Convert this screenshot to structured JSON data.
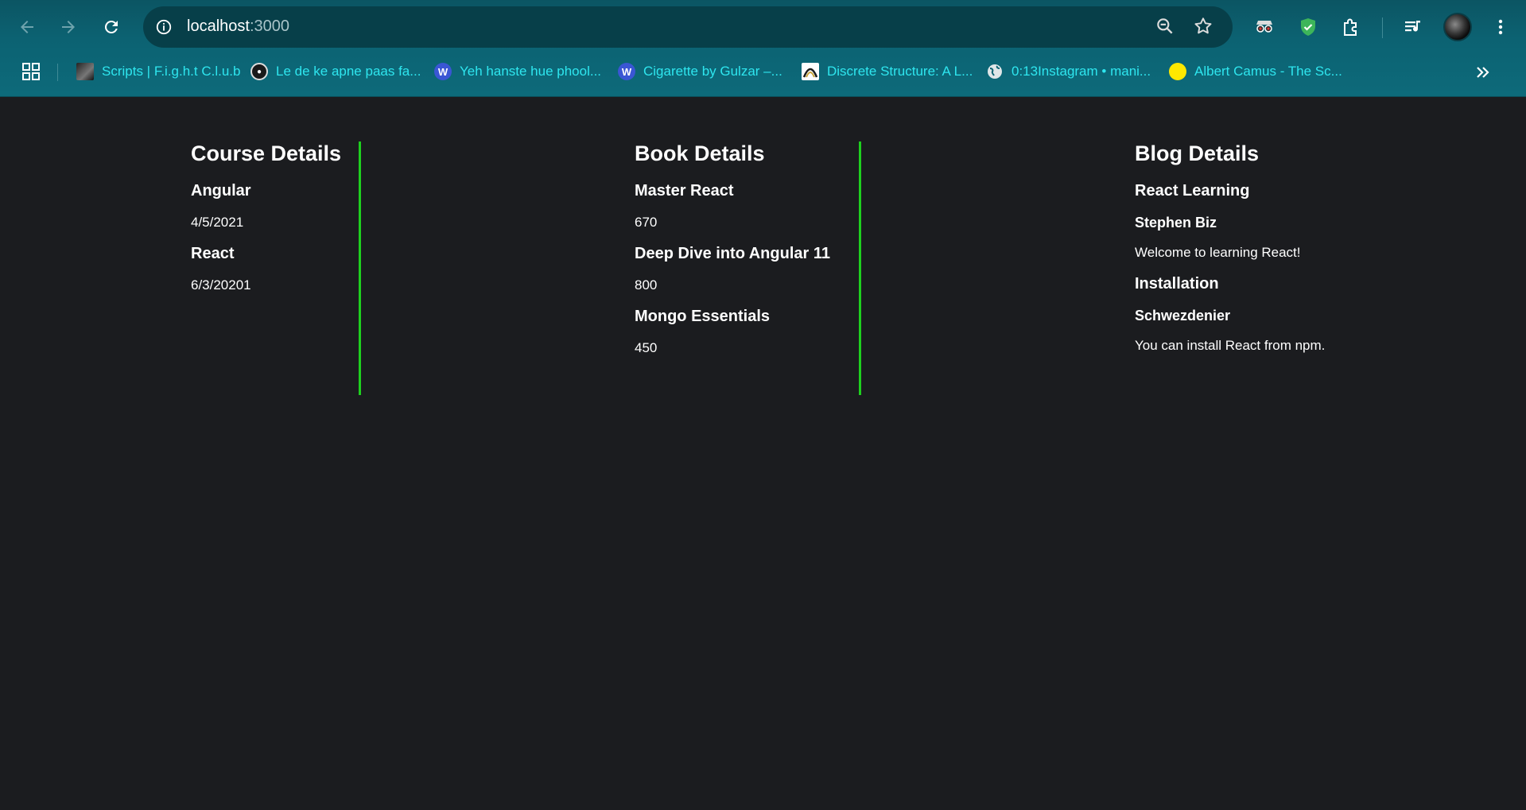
{
  "browser": {
    "url_host": "localhost",
    "url_port": ":3000",
    "bookmarks": [
      {
        "label": "Scripts | F.i.g.h.t C.l.u.b",
        "icon": "film-thumbnail-icon"
      },
      {
        "label": "Le de ke apne paas fa...",
        "icon": "podcast-icon"
      },
      {
        "label": "Yeh hanste hue phool...",
        "icon": "wordpress-icon"
      },
      {
        "label": "Cigarette by Gulzar –...",
        "icon": "wordpress-icon"
      },
      {
        "label": "Discrete Structure: A L...",
        "icon": "arch-logo-icon"
      },
      {
        "label": "0:13Instagram • mani...",
        "icon": "globe-icon"
      },
      {
        "label": "Albert Camus - The Sc...",
        "icon": "yellow-circle-icon"
      }
    ]
  },
  "courses": {
    "title": "Course Details",
    "items": [
      {
        "name": "Angular",
        "date": "4/5/2021"
      },
      {
        "name": "React",
        "date": "6/3/20201"
      }
    ]
  },
  "books": {
    "title": "Book Details",
    "items": [
      {
        "name": "Master React",
        "price": "670"
      },
      {
        "name": "Deep Dive into Angular 11",
        "price": "800"
      },
      {
        "name": "Mongo Essentials",
        "price": "450"
      }
    ]
  },
  "blogs": {
    "title": "Blog Details",
    "items": [
      {
        "title": "React Learning",
        "author": "Stephen Biz",
        "content": "Welcome to learning React!"
      },
      {
        "title": "Installation",
        "author": "Schwezdenier",
        "content": "You can install React from npm."
      }
    ]
  },
  "colors": {
    "divider": "#1ed01e",
    "background": "#1b1c1f",
    "bookmark_text": "#2ee6ef"
  }
}
